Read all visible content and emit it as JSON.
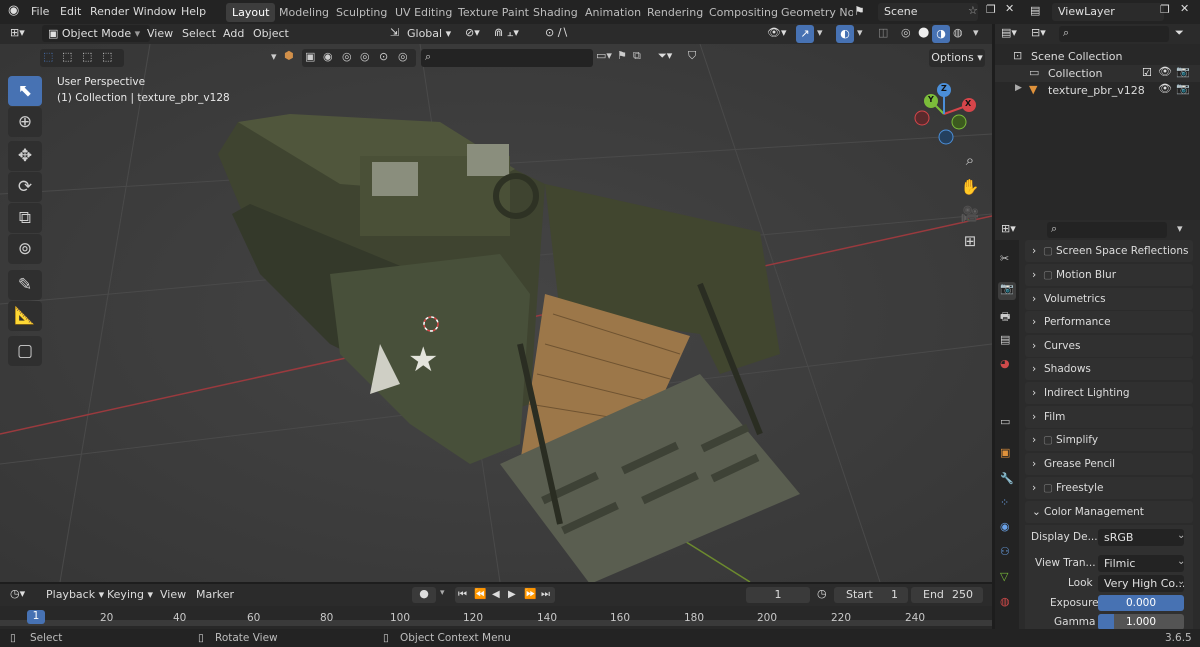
{
  "menu": [
    "File",
    "Edit",
    "Render",
    "Window",
    "Help"
  ],
  "workspace_tabs": [
    {
      "label": "Layout",
      "active": true
    },
    {
      "label": "Modeling"
    },
    {
      "label": "Sculpting"
    },
    {
      "label": "UV Editing"
    },
    {
      "label": "Texture Paint"
    },
    {
      "label": "Shading"
    },
    {
      "label": "Animation"
    },
    {
      "label": "Rendering"
    },
    {
      "label": "Compositing"
    },
    {
      "label": "Geometry Noc"
    }
  ],
  "scene": {
    "label": "Scene"
  },
  "view_layer": {
    "label": "ViewLayer"
  },
  "viewport_header": {
    "mode": "Object Mode",
    "menus": [
      "View",
      "Select",
      "Add",
      "Object"
    ],
    "transform_orientation": "Global",
    "options_label": "Options"
  },
  "viewport_overlay": {
    "perspective": "User Perspective",
    "collection_info": "(1) Collection | texture_pbr_v128"
  },
  "gizmo": {
    "x": "X",
    "y": "Y",
    "z": "Z"
  },
  "outliner": {
    "scene_collection": "Scene Collection",
    "collection": "Collection",
    "object": "texture_pbr_v128"
  },
  "properties": {
    "panels": [
      {
        "label": "Screen Space Reflections",
        "checkbox": true,
        "expanded": false
      },
      {
        "label": "Motion Blur",
        "checkbox": true,
        "expanded": false
      },
      {
        "label": "Volumetrics",
        "checkbox": false,
        "expanded": false
      },
      {
        "label": "Performance",
        "checkbox": false,
        "expanded": false
      },
      {
        "label": "Curves",
        "checkbox": false,
        "expanded": false
      },
      {
        "label": "Shadows",
        "checkbox": false,
        "expanded": false
      },
      {
        "label": "Indirect Lighting",
        "checkbox": false,
        "expanded": false
      },
      {
        "label": "Film",
        "checkbox": false,
        "expanded": false
      },
      {
        "label": "Simplify",
        "checkbox": true,
        "expanded": false
      },
      {
        "label": "Grease Pencil",
        "checkbox": false,
        "expanded": false
      },
      {
        "label": "Freestyle",
        "checkbox": true,
        "expanded": false
      },
      {
        "label": "Color Management",
        "checkbox": false,
        "expanded": true
      }
    ],
    "color_management": {
      "display_device_label": "Display De...",
      "display_device_value": "sRGB",
      "view_transform_label": "View Tran...",
      "view_transform_value": "Filmic",
      "look_label": "Look",
      "look_value": "Very High Co...",
      "exposure_label": "Exposure",
      "exposure_value": "0.000",
      "gamma_label": "Gamma",
      "gamma_value": "1.000"
    }
  },
  "timeline": {
    "menus": [
      "Playback",
      "Keying",
      "View",
      "Marker"
    ],
    "current_frame": "1",
    "start_label": "Start",
    "start_value": "1",
    "end_label": "End",
    "end_value": "250",
    "ruler": [
      "1",
      "20",
      "40",
      "60",
      "80",
      "100",
      "120",
      "140",
      "160",
      "180",
      "200",
      "220",
      "240"
    ]
  },
  "status_bar": {
    "select": "Select",
    "rotate": "Rotate View",
    "context_menu": "Object Context Menu",
    "version": "3.6.5"
  },
  "colors": {
    "accent": "#4772b3",
    "x_axis": "#d6454a",
    "y_axis": "#7bbd3a",
    "z_axis": "#4b8fd9"
  }
}
